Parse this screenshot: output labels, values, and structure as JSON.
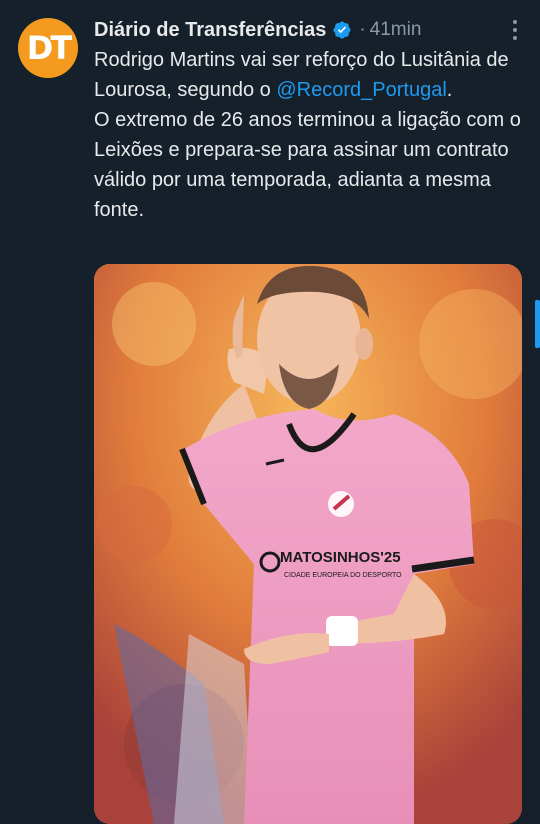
{
  "tweet": {
    "author_name": "Diário de Transferências",
    "separator": "·",
    "timestamp": "41min",
    "avatar_text": "DT",
    "text_line1": "Rodrigo Martins vai ser reforço do Lusitânia de Lourosa, segundo o ",
    "mention": "@Record_Portugal",
    "mention_suffix": ".",
    "text_paragraph2": "O extremo de 26 anos terminou a ligação com o Leixões e prepara-se para assinar um contrato válido por uma temporada, adianta a mesma fonte."
  },
  "media": {
    "shirt_sponsor": "MATOSINHOS'25",
    "shirt_sub": "CIDADE EUROPEIA DO DESPORTO"
  },
  "colors": {
    "background": "#15202b",
    "accent": "#1d9bf0",
    "text": "#e7e9ea",
    "muted": "#8b98a5",
    "avatar": "#f39a1f"
  }
}
